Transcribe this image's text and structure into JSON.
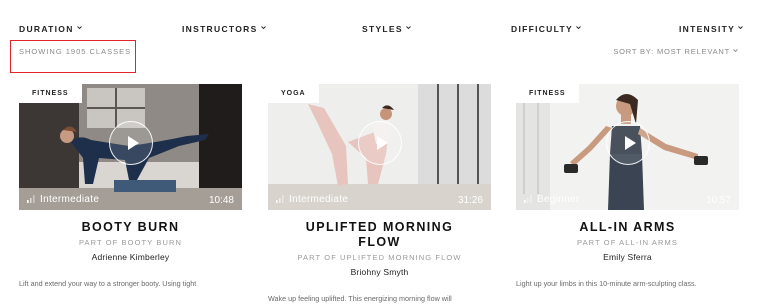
{
  "filters": [
    {
      "label": "DURATION"
    },
    {
      "label": "INSTRUCTORS"
    },
    {
      "label": "STYLES"
    },
    {
      "label": "DIFFICULTY"
    },
    {
      "label": "INTENSITY"
    }
  ],
  "results": {
    "showing": "SHOWING 1905 CLASSES",
    "sort_label": "SORT BY: MOST RELEVANT"
  },
  "colors": {
    "highlight": "#e0262b"
  },
  "cards": [
    {
      "tag": "FITNESS",
      "level": "Intermediate",
      "duration": "10:48",
      "title": "BOOTY BURN",
      "part_of": "PART OF BOOTY BURN",
      "instructor": "Adrienne Kimberley",
      "description": "Lift and extend your way to a stronger booty. Using tight"
    },
    {
      "tag": "YOGA",
      "level": "Intermediate",
      "duration": "31:26",
      "title_line1": "UPLIFTED MORNING",
      "title_line2": "FLOW",
      "part_of": "PART OF UPLIFTED MORNING FLOW",
      "instructor": "Briohny Smyth",
      "description": "Wake up feeling uplifted. This energizing morning flow will"
    },
    {
      "tag": "FITNESS",
      "level": "Beginner",
      "duration": "10:57",
      "title": "ALL-IN ARMS",
      "part_of": "PART OF ALL-IN ARMS",
      "instructor": "Emily Sferra",
      "description": "Light up your limbs in this 10-minute arm-sculpting class."
    }
  ]
}
